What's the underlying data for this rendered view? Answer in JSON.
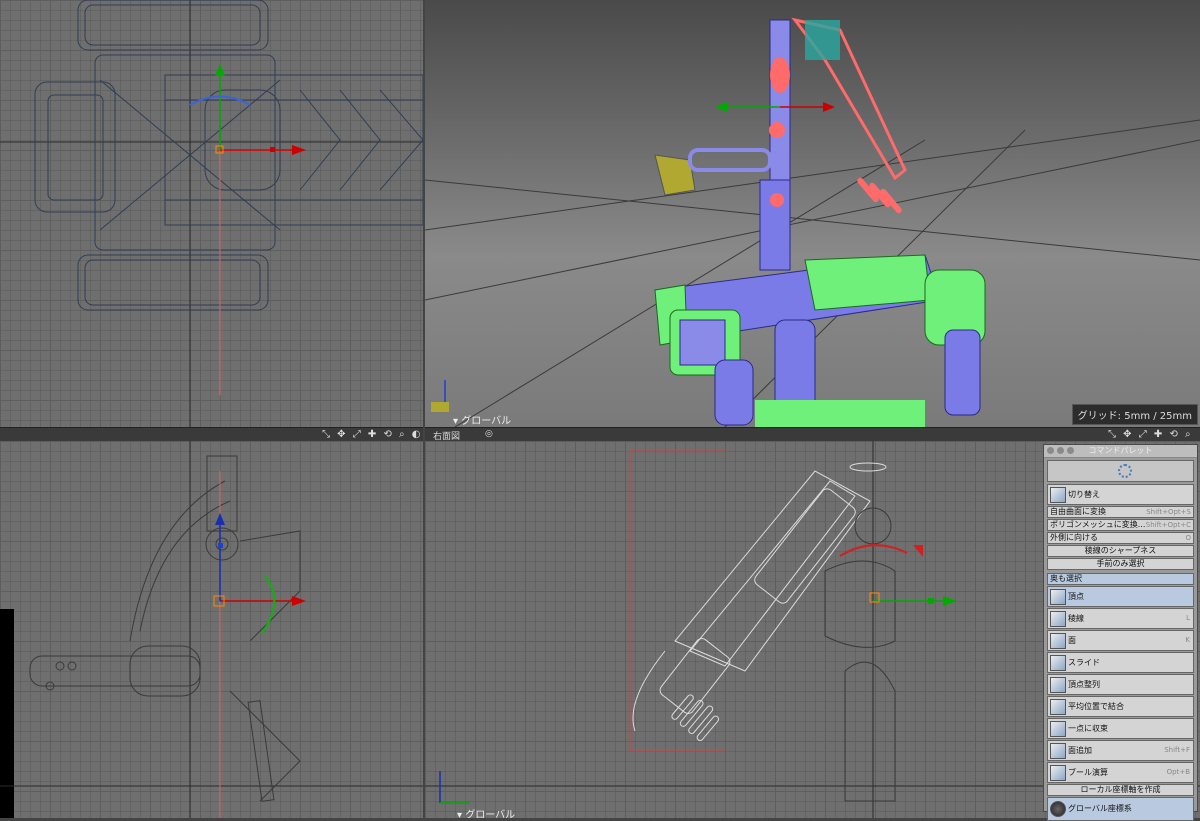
{
  "viewports": {
    "perspective": {
      "axis_label": "グローバル",
      "grid_label": "グリッド: 5mm / 25mm"
    },
    "front": {
      "tools": "⤡ ✥ ⤢ ✚ ⟲ ⌕ ◐"
    },
    "right": {
      "name": "右面図",
      "tools": "⤡ ✥ ⤢ ✚ ⟲ ⌕ ◐",
      "axis_label": "グローバル"
    }
  },
  "command_palette": {
    "title": "コマンドパレット",
    "switch_label": "切り替え",
    "rows": [
      {
        "label": "自由曲面に変換",
        "shortcut": "Shift+Opt+S"
      },
      {
        "label": "ポリゴンメッシュに変換...",
        "shortcut": "Shift+Opt+C"
      },
      {
        "label": "外側に向ける",
        "shortcut": "O"
      }
    ],
    "centered_rows": [
      "稜線のシャープネス",
      "手前のみ選択"
    ],
    "back_select": "奥も選択",
    "tools": [
      {
        "label": "頂点",
        "shortcut": "",
        "icon": "vertex-icon",
        "selected": true
      },
      {
        "label": "稜線",
        "shortcut": "L",
        "icon": "edge-icon",
        "selected": false
      },
      {
        "label": "面",
        "shortcut": "K",
        "icon": "face-icon",
        "selected": false
      },
      {
        "label": "スライド",
        "shortcut": "",
        "icon": "slide-icon",
        "selected": false
      },
      {
        "label": "頂点整列",
        "shortcut": "",
        "icon": "align-vertices-icon",
        "selected": false
      },
      {
        "label": "平均位置で結合",
        "shortcut": "",
        "icon": "merge-average-icon",
        "selected": false
      },
      {
        "label": "一点に収束",
        "shortcut": "",
        "icon": "collapse-point-icon",
        "selected": false
      },
      {
        "label": "面追加",
        "shortcut": "Shift+F",
        "icon": "add-face-icon",
        "selected": false
      },
      {
        "label": "ブール演算",
        "shortcut": "Opt+B",
        "icon": "boolean-icon",
        "selected": false
      }
    ],
    "local_axis_label": "ローカル座標軸を作成",
    "global_coords_label": "グローバル座標系"
  },
  "colors": {
    "x_axis": "#d01010",
    "y_axis": "#10b010",
    "z_axis": "#1030c0",
    "selection": "#ff6b6b",
    "mesh_blue": "#7b7be8",
    "mesh_green": "#6ef07a"
  }
}
